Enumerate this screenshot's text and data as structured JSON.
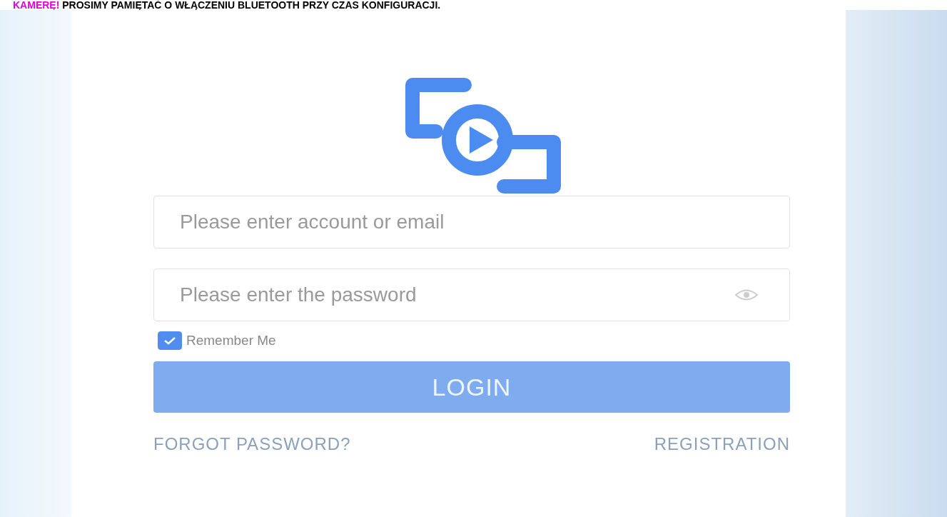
{
  "banner": {
    "highlight": "KAMERĘ!",
    "text": "PROSIMY PAMIĘTAĆ O WŁĄCZENIU BLUETOOTH PRZY CZAS KONFIGURACJI."
  },
  "form": {
    "account": {
      "placeholder": "Please enter account or email"
    },
    "password": {
      "placeholder": "Please enter the password"
    },
    "remember": {
      "label": "Remember Me",
      "checked": true
    },
    "login": "LOGIN",
    "links": [
      "FORGOT PASSWORD?",
      "REGISTRATION"
    ]
  }
}
